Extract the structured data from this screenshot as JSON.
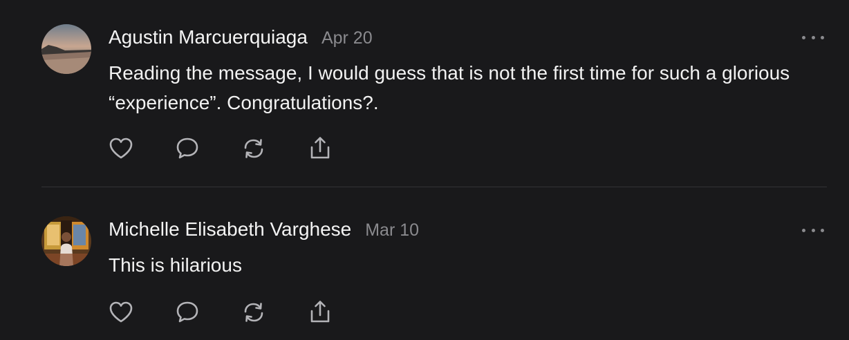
{
  "comments": [
    {
      "author": "Agustin Marcuerquiaga",
      "date": "Apr 20",
      "text": "Reading the message, I would guess that is not the first time for such a glorious “experience”. Congratulations?.",
      "avatar": "beach-landscape-photo"
    },
    {
      "author": "Michelle Elisabeth Varghese",
      "date": "Mar 10",
      "text": "This is hilarious",
      "avatar": "person-at-window-photo"
    }
  ],
  "actions": [
    {
      "icon": "heart-icon"
    },
    {
      "icon": "comment-icon"
    },
    {
      "icon": "repost-icon"
    },
    {
      "icon": "share-icon"
    }
  ],
  "colors": {
    "background": "#19191b",
    "text": "#f2f2f2",
    "muted": "#8a8a8e",
    "divider": "#333336"
  }
}
